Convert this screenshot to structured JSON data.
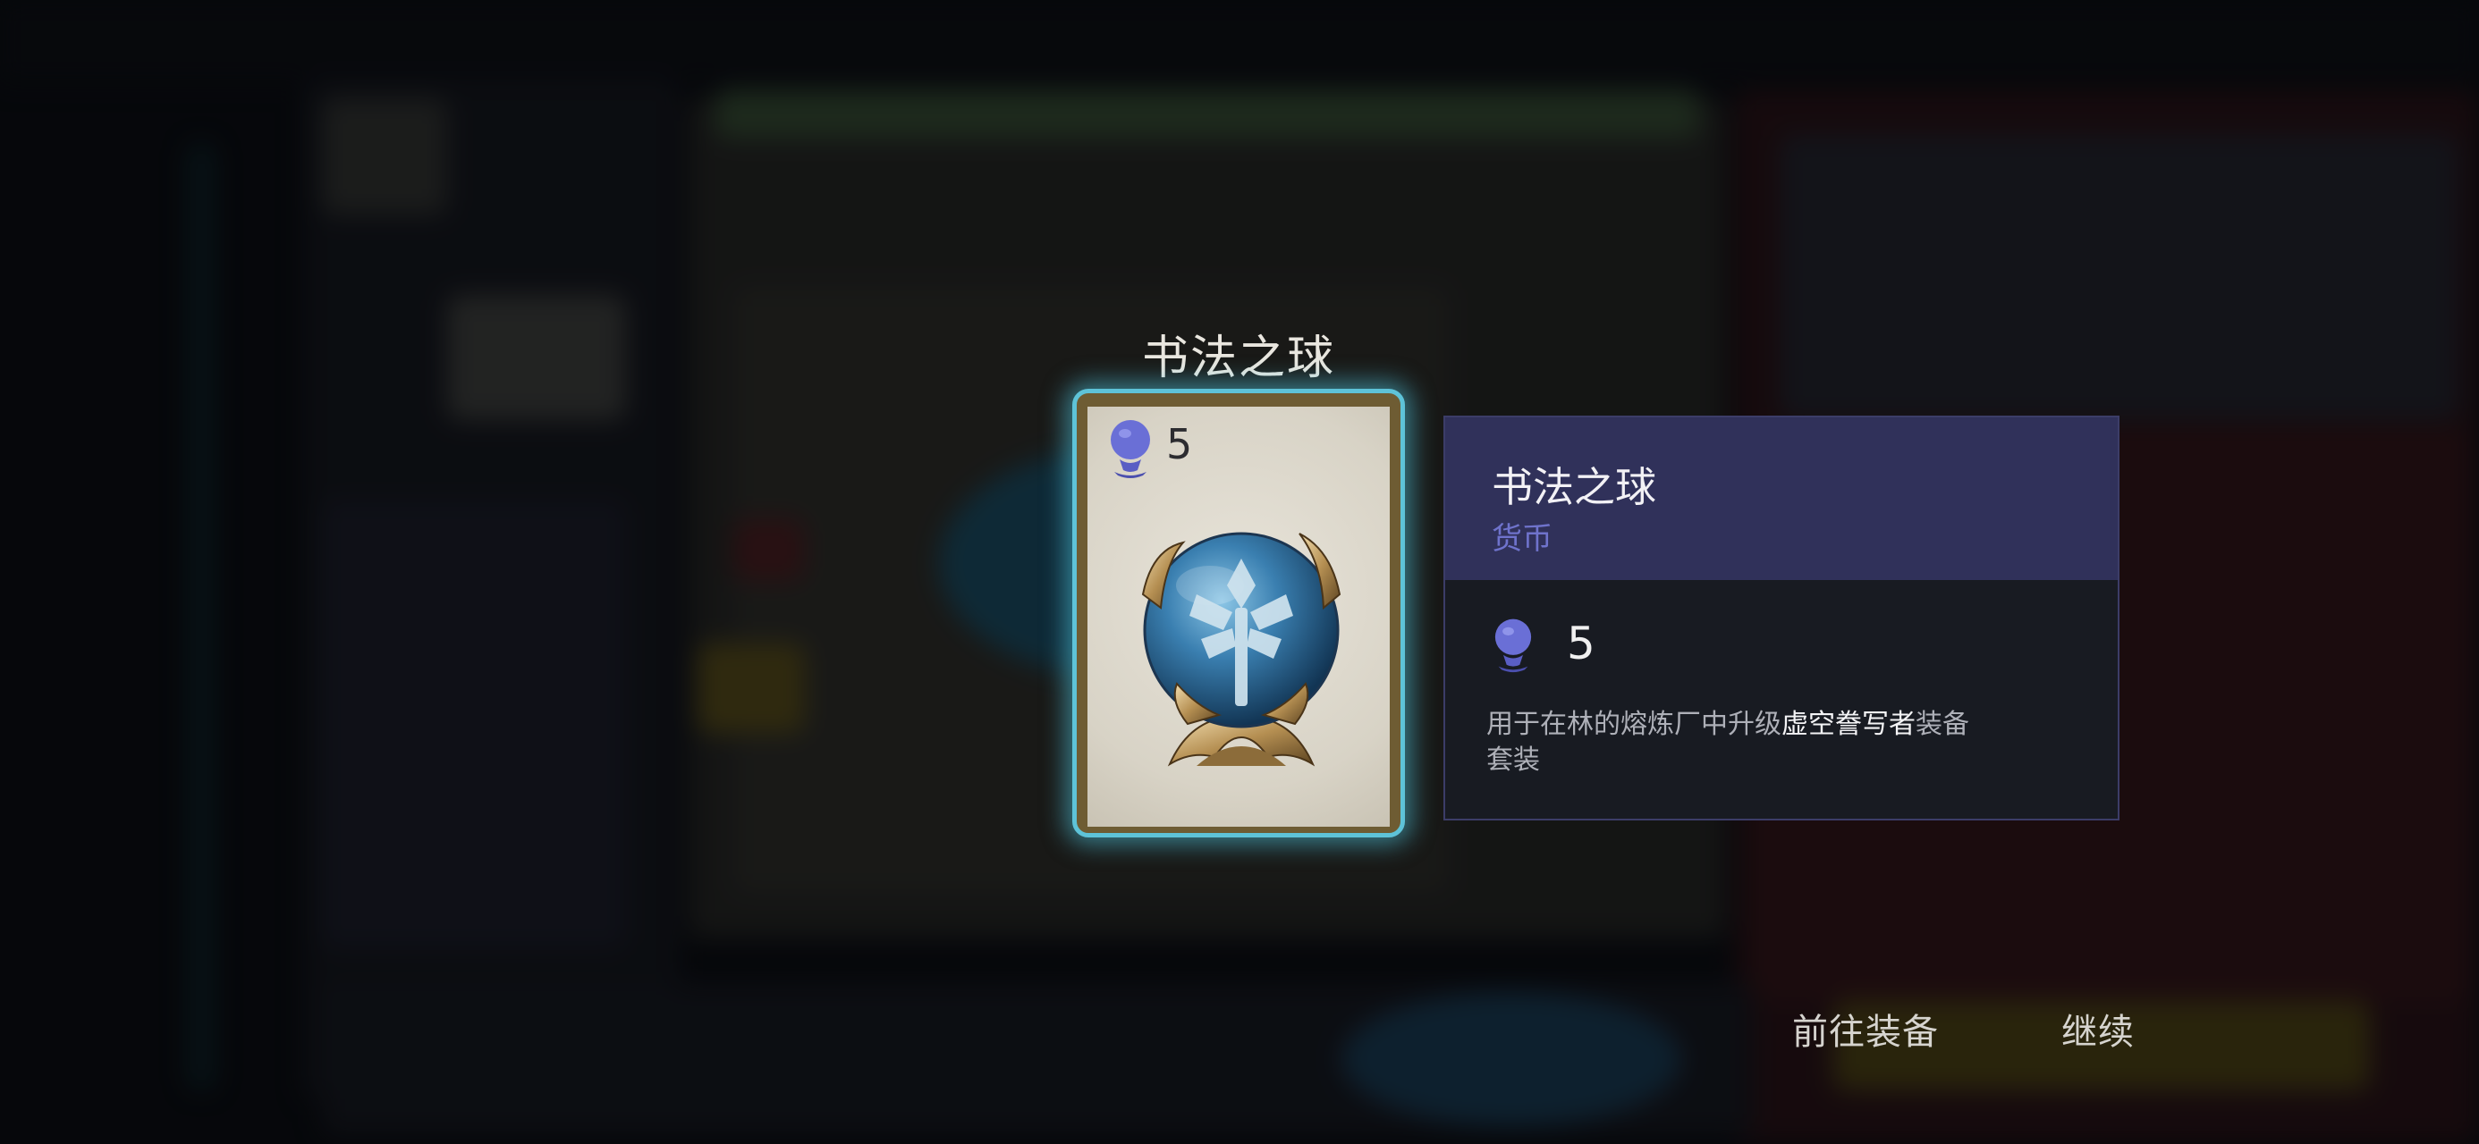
{
  "item": {
    "title": "书法之球",
    "cost": "5"
  },
  "tooltip": {
    "name": "书法之球",
    "type": "货币",
    "cost": "5",
    "description": {
      "prefix": "用于在林的熔炼厂中升级",
      "highlight": "虚空誊写者",
      "suffix": "装备",
      "line2": "套装"
    }
  },
  "actions": {
    "goto_equip_label": "前往装备",
    "continue_label": "继续"
  },
  "colors": {
    "card_glow": "#5ec3d8",
    "tooltip_header": "#30315a",
    "type_text": "#6f73cc",
    "currency_icon": "#6a6fd6"
  },
  "icons": {
    "currency": "purple-orb-token-icon",
    "item_art": "calligraphy-orb-art"
  }
}
